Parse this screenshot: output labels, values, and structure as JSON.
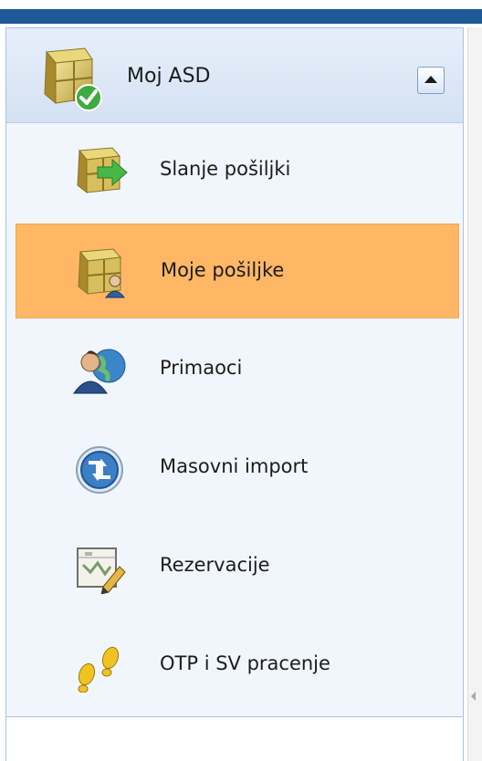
{
  "header": {
    "title": "Moj ASD",
    "icon": "package-check-icon",
    "collapse_icon": "chevron-up-icon"
  },
  "menu": {
    "items": [
      {
        "label": "Slanje pošiljki",
        "icon": "package-send-icon",
        "selected": false
      },
      {
        "label": "Moje pošiljke",
        "icon": "package-user-icon",
        "selected": true
      },
      {
        "label": "Primaoci",
        "icon": "users-globe-icon",
        "selected": false
      },
      {
        "label": "Masovni import",
        "icon": "import-arrows-icon",
        "selected": false
      },
      {
        "label": "Rezervacije",
        "icon": "reservation-edit-icon",
        "selected": false
      },
      {
        "label": "OTP i SV pracenje",
        "icon": "footprints-icon",
        "selected": false
      }
    ]
  },
  "colors": {
    "selected_bg": "#ffb766",
    "panel_bg": "#f1f6fc",
    "header_strip": "#1e5a98"
  }
}
